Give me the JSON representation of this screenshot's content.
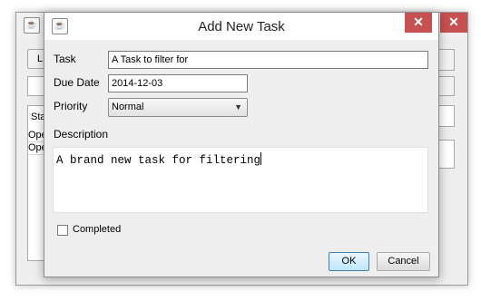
{
  "background_window": {
    "button_label": "L",
    "table_header": "Sta",
    "rows": [
      "Ope",
      "Ope"
    ]
  },
  "dialog": {
    "title": "Add New Task",
    "close_label": "✕",
    "app_icon": "java-cup-icon",
    "fields": {
      "task_label": "Task",
      "task_value": "A Task to filter for",
      "due_date_label": "Due Date",
      "due_date_value": "2014-12-03",
      "priority_label": "Priority",
      "priority_value": "Normal",
      "description_label": "Description",
      "description_value": "A brand new task for filtering",
      "completed_label": "Completed",
      "completed_checked": false
    },
    "buttons": {
      "ok": "OK",
      "cancel": "Cancel"
    }
  },
  "colors": {
    "close_button": "#c75050",
    "ok_border": "#3c7fb1"
  }
}
